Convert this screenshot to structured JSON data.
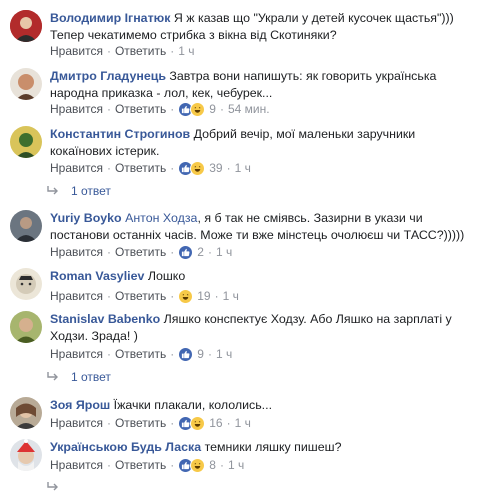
{
  "actions": {
    "like": "Нравится",
    "reply": "Ответить"
  },
  "comments": [
    {
      "author": "Володимир Ігнатюк",
      "text": "Я ж казав що \"Украли у детей кусочек щастья\")))\nТепер чекатимемо стрибка з вікна від Скотиняки?",
      "reactions": [],
      "count": "",
      "time": "1 ч",
      "avatar_color": "#b22b2b"
    },
    {
      "author": "Дмитро Гладунець",
      "text": "Завтра вони напишуть: як говорить українська народна приказка - лол, кек, чебурек...",
      "reactions": [
        "like",
        "haha"
      ],
      "count": "9",
      "time": "54 мин.",
      "avatar_color": "#8a6a52"
    },
    {
      "author": "Константин Строгинов",
      "text": "Добрий вечір, мої маленьки заручники кокаїнових істерик.",
      "reactions": [
        "like",
        "haha"
      ],
      "count": "39",
      "time": "1 ч",
      "avatar_color": "#c9a93a",
      "replies": "1 ответ"
    },
    {
      "author": "Yuriy Boyko",
      "mention": "Антон Ходза",
      "text": ", я б так не сміявсь. Зазирни в укази чи постанови останніх часів. Може ти вже мінстець очолюєш чи ТАСС?)))))",
      "reactions": [
        "like"
      ],
      "count": "2",
      "time": "1 ч",
      "avatar_color": "#3f4a56"
    },
    {
      "author": "Roman Vasyliev",
      "text": "Лошко",
      "reactions": [
        "haha"
      ],
      "count": "19",
      "time": "1 ч",
      "avatar_color": "#d8d2c4"
    },
    {
      "author": "Stanislav Babenko",
      "text": "Ляшко конспектує Ходзу. Або Ляшко на зарплаті у Ходзи. Зрада! )",
      "reactions": [
        "like"
      ],
      "count": "9",
      "time": "1 ч",
      "avatar_color": "#5d7a2e",
      "replies": "1 ответ"
    },
    {
      "author": "Зоя Ярош",
      "text": "Їжачки плакали, кололись...",
      "reactions": [
        "like",
        "haha"
      ],
      "count": "16",
      "time": "1 ч",
      "avatar_color": "#8f7d6c"
    },
    {
      "author": "Українською Будь Ласка",
      "text": "темники ляшку пишеш?",
      "reactions": [
        "like",
        "haha"
      ],
      "count": "8",
      "time": "1 ч",
      "avatar_color": "#2a3340"
    }
  ],
  "icons": {
    "like": "thumbs-up-icon",
    "haha": "laughing-face-icon",
    "reply_arrow": "reply-arrow-icon"
  }
}
